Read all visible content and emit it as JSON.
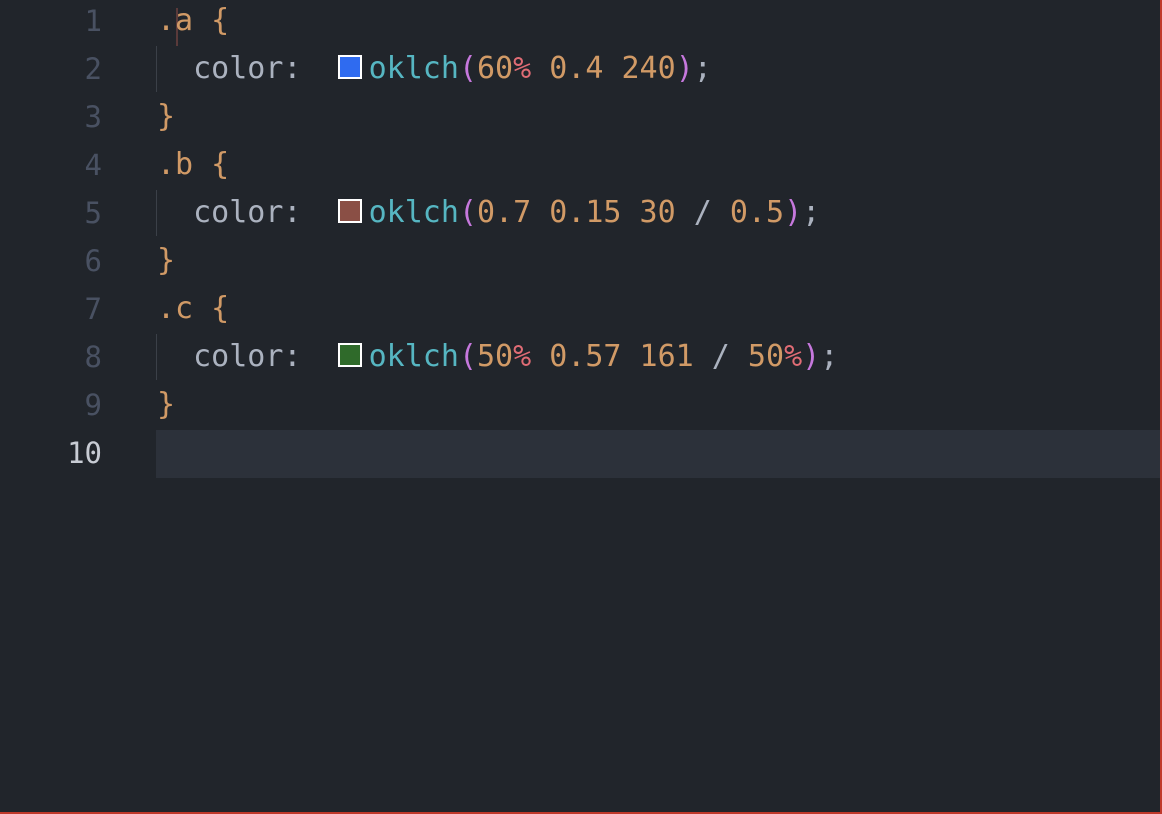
{
  "editor": {
    "lines": [
      {
        "num": "1",
        "selector": ".a",
        "brace": " {"
      },
      {
        "num": "2",
        "prop": "color:",
        "fn": "oklch",
        "open": "(",
        "args": [
          {
            "v": "60",
            "u": "%"
          },
          {
            "v": " 0.4"
          },
          {
            "v": " 240"
          }
        ],
        "close": ")",
        "end": ";",
        "swatch": "#2f6bf0"
      },
      {
        "num": "3",
        "brace": "}"
      },
      {
        "num": "4",
        "selector": ".b",
        "brace": " {"
      },
      {
        "num": "5",
        "prop": "color:",
        "fn": "oklch",
        "open": "(",
        "args": [
          {
            "v": "0.7"
          },
          {
            "v": " 0.15"
          },
          {
            "v": " 30"
          },
          {
            "s": " /"
          },
          {
            "v": " 0.5"
          }
        ],
        "close": ")",
        "end": ";",
        "swatch": "#8a4f45"
      },
      {
        "num": "6",
        "brace": "}"
      },
      {
        "num": "7",
        "selector": ".c",
        "brace": " {"
      },
      {
        "num": "8",
        "prop": "color:",
        "fn": "oklch",
        "open": "(",
        "args": [
          {
            "v": "50",
            "u": "%"
          },
          {
            "v": " 0.57"
          },
          {
            "v": " 161"
          },
          {
            "s": " /"
          },
          {
            "v": " 50",
            "u": "%"
          }
        ],
        "close": ")",
        "end": ";",
        "swatch": "#2f6a2a"
      },
      {
        "num": "9",
        "brace": "}"
      },
      {
        "num": "10"
      }
    ],
    "active_line": "10"
  }
}
